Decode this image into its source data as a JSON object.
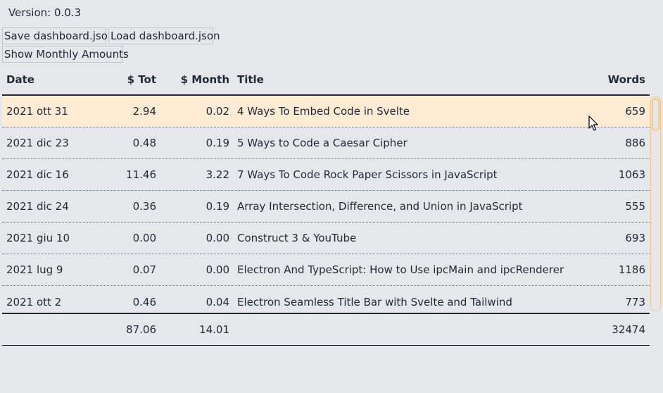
{
  "app": {
    "version_text": "Version: 0.0.3"
  },
  "toolbar": {
    "save_label": "Save dashboard.json",
    "load_label": "Load dashboard.json",
    "monthly_label": "Show Monthly Amounts"
  },
  "table": {
    "headers": {
      "date": "Date",
      "tot": "$ Tot",
      "month": "$ Month",
      "title": "Title",
      "words": "Words"
    },
    "rows": [
      {
        "date": "2021 ott 31",
        "tot": "2.94",
        "month": "0.02",
        "title": "4 Ways To Embed Code in Svelte",
        "words": "659"
      },
      {
        "date": "2021 dic 23",
        "tot": "0.48",
        "month": "0.19",
        "title": "5 Ways to Code a Caesar Cipher",
        "words": "886"
      },
      {
        "date": "2021 dic 16",
        "tot": "11.46",
        "month": "3.22",
        "title": "7 Ways To Code Rock Paper Scissors in JavaScript",
        "words": "1063"
      },
      {
        "date": "2021 dic 24",
        "tot": "0.36",
        "month": "0.19",
        "title": "Array Intersection, Difference, and Union in JavaScript",
        "words": "555"
      },
      {
        "date": "2021 giu 10",
        "tot": "0.00",
        "month": "0.00",
        "title": "Construct 3 & YouTube",
        "words": "693"
      },
      {
        "date": "2021 lug 9",
        "tot": "0.07",
        "month": "0.00",
        "title": "Electron And TypeScript: How to Use ipcMain and ipcRenderer",
        "words": "1186"
      },
      {
        "date": "2021 ott 2",
        "tot": "0.46",
        "month": "0.04",
        "title": "Electron Seamless Title Bar with Svelte and Tailwind",
        "words": "773"
      }
    ],
    "totals": {
      "tot": "87.06",
      "month": "14.01",
      "words": "32474"
    }
  },
  "colors": {
    "background": "#e5e7eb",
    "highlight_row": "#fdebd3",
    "scrollbar_accent": "#f5c78f",
    "text": "#1f2937"
  }
}
